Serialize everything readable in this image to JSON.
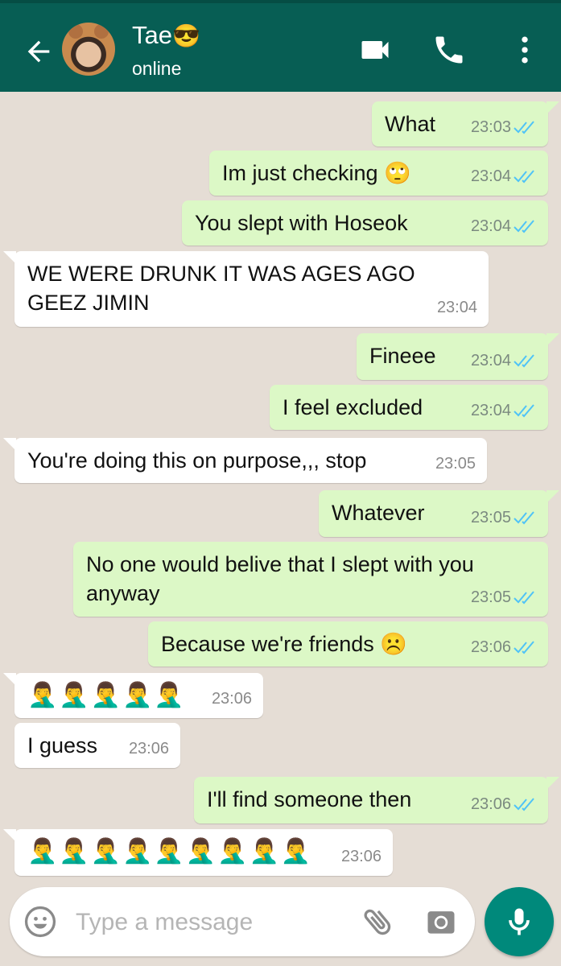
{
  "header": {
    "name": "Tae",
    "name_emoji": "😎",
    "status": "online",
    "icons": [
      "back-arrow-icon",
      "video-call-icon",
      "phone-icon",
      "more-vert-icon"
    ]
  },
  "messages": [
    {
      "dir": "out",
      "text": "What",
      "time": "23:03"
    },
    {
      "dir": "out",
      "text": "Im just checking 🙄",
      "time": "23:04"
    },
    {
      "dir": "out",
      "text": "You slept with Hoseok",
      "time": "23:04"
    },
    {
      "dir": "in",
      "text": "WE WERE DRUNK IT WAS AGES AGO GEEZ JIMIN",
      "time": "23:04"
    },
    {
      "dir": "out",
      "text": "Fineee",
      "time": "23:04"
    },
    {
      "dir": "out",
      "text": "I feel excluded",
      "time": "23:04"
    },
    {
      "dir": "in",
      "text": "You're doing this on purpose,,, stop",
      "time": "23:05"
    },
    {
      "dir": "out",
      "text": "Whatever",
      "time": "23:05"
    },
    {
      "dir": "out",
      "text": "No one would belive that I slept with you anyway",
      "time": "23:05"
    },
    {
      "dir": "out",
      "text": "Because we're friends ☹️",
      "time": "23:06"
    },
    {
      "dir": "in",
      "text": "🤦‍♂️🤦‍♂️🤦‍♂️🤦‍♂️🤦‍♂️",
      "time": "23:06"
    },
    {
      "dir": "in",
      "text": "I guess",
      "time": "23:06"
    },
    {
      "dir": "out",
      "text": "I'll find someone then",
      "time": "23:06"
    },
    {
      "dir": "in",
      "text": "🤦‍♂️🤦‍♂️🤦‍♂️🤦‍♂️🤦‍♂️🤦‍♂️🤦‍♂️🤦‍♂️🤦‍♂️",
      "time": "23:06"
    }
  ],
  "composer": {
    "placeholder": "Type a message",
    "icons": [
      "emoji-icon",
      "attach-icon",
      "camera-icon",
      "mic-icon"
    ]
  },
  "colors": {
    "header": "#075e54",
    "outgoing_bubble": "#dcf8c6",
    "incoming_bubble": "#ffffff",
    "read_ticks": "#4fc3f7",
    "mic_button": "#00897b"
  }
}
